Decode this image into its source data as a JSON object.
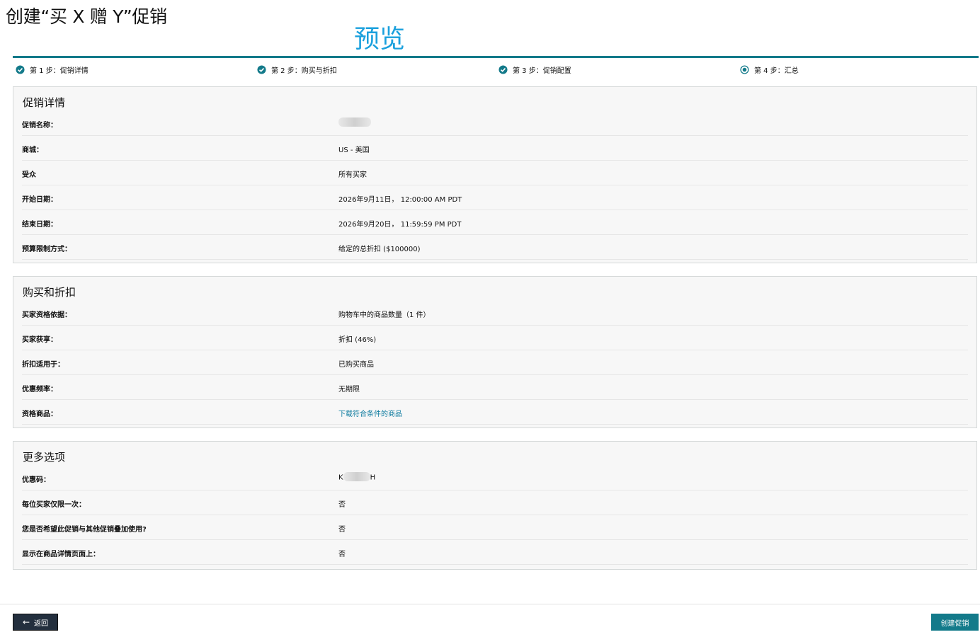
{
  "page": {
    "title": "创建“买 X 赠 Y”促销",
    "preview_label": "预览"
  },
  "steps": [
    {
      "label": "第 1 步：促销详情",
      "state": "complete",
      "icon": "check-circle-icon"
    },
    {
      "label": "第 2 步：购买与折扣",
      "state": "complete",
      "icon": "check-circle-icon"
    },
    {
      "label": "第 3 步：促销配置",
      "state": "complete",
      "icon": "check-circle-icon"
    },
    {
      "label": "第 4 步：汇总",
      "state": "current",
      "icon": "radio-selected-icon"
    }
  ],
  "sections": {
    "promo_details": {
      "title": "促销详情",
      "rows": [
        {
          "label": "促销名称：",
          "value": ""
        },
        {
          "label": "商城：",
          "value": "US - 美国"
        },
        {
          "label": "受众",
          "value": "所有买家"
        },
        {
          "label": "开始日期：",
          "value": "2026年9月11日， 12:00:00 AM PDT"
        },
        {
          "label": "结束日期：",
          "value": "2026年9月20日， 11:59:59 PM PDT"
        },
        {
          "label": "预算限制方式：",
          "value": "给定的总折扣 ($100000)"
        }
      ]
    },
    "purchase_discount": {
      "title": "购买和折扣",
      "rows": [
        {
          "label": "买家资格依据：",
          "value": "购物车中的商品数量（1 件）"
        },
        {
          "label": "买家获享：",
          "value": "折扣 (46%)"
        },
        {
          "label": "折扣适用于：",
          "value": "已购买商品"
        },
        {
          "label": "优惠频率：",
          "value": "无期限"
        },
        {
          "label": "资格商品：",
          "value": "下载符合条件的商品"
        }
      ]
    },
    "more_options": {
      "title": "更多选项",
      "rows": [
        {
          "label": "优惠码：",
          "value_prefix": "K",
          "value_suffix": "H"
        },
        {
          "label": "每位买家仅限一次：",
          "value": "否"
        },
        {
          "label": "您是否希望此促销与其他促销叠加使用?",
          "value": "否"
        },
        {
          "label": "显示在商品详情页面上：",
          "value": "否"
        }
      ]
    }
  },
  "footer": {
    "back_label": "返回",
    "create_label": "创建促销"
  },
  "colors": {
    "accent": "#137a8a",
    "preview": "#1aa0dd",
    "link": "#0b7a9e"
  }
}
